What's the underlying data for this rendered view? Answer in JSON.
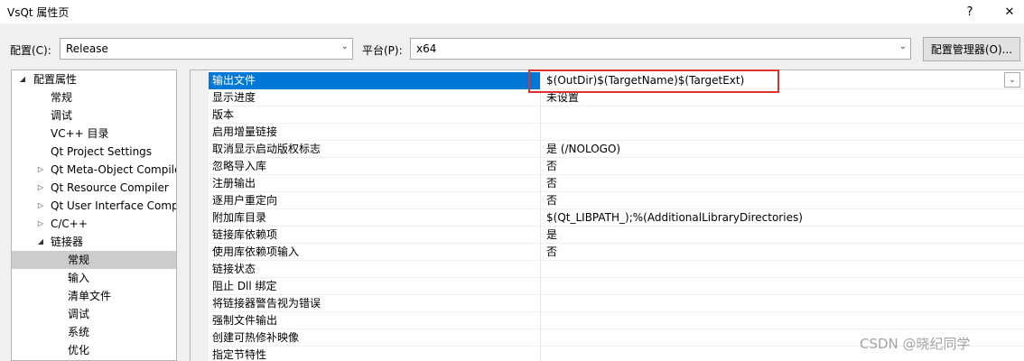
{
  "window": {
    "title": "VsQt 属性页",
    "help_label": "?",
    "close_label": "✕"
  },
  "config_bar": {
    "config_label": "配置(C):",
    "config_value": "Release",
    "platform_label": "平台(P):",
    "platform_value": "x64",
    "manager_button": "配置管理器(O)..."
  },
  "tree": {
    "items": [
      {
        "label": "配置属性",
        "toggle": "◢"
      },
      {
        "label": "常规",
        "toggle": ""
      },
      {
        "label": "调试",
        "toggle": ""
      },
      {
        "label": "VC++ 目录",
        "toggle": ""
      },
      {
        "label": "Qt Project Settings",
        "toggle": ""
      },
      {
        "label": "Qt Meta-Object Compile",
        "toggle": "▷"
      },
      {
        "label": "Qt Resource Compiler",
        "toggle": "▷"
      },
      {
        "label": "Qt User Interface Comp",
        "toggle": "▷"
      },
      {
        "label": "C/C++",
        "toggle": "▷"
      },
      {
        "label": "链接器",
        "toggle": "◢"
      },
      {
        "label": "常规",
        "toggle": ""
      },
      {
        "label": "输入",
        "toggle": ""
      },
      {
        "label": "清单文件",
        "toggle": ""
      },
      {
        "label": "调试",
        "toggle": ""
      },
      {
        "label": "系统",
        "toggle": ""
      },
      {
        "label": "优化",
        "toggle": ""
      }
    ]
  },
  "properties": [
    {
      "name": "输出文件",
      "value": "$(OutDir)$(TargetName)$(TargetExt)"
    },
    {
      "name": "显示进度",
      "value": "未设置"
    },
    {
      "name": "版本",
      "value": ""
    },
    {
      "name": "启用增量链接",
      "value": ""
    },
    {
      "name": "取消显示启动版权标志",
      "value": "是 (/NOLOGO)"
    },
    {
      "name": "忽略导入库",
      "value": "否"
    },
    {
      "name": "注册输出",
      "value": "否"
    },
    {
      "name": "逐用户重定向",
      "value": "否"
    },
    {
      "name": "附加库目录",
      "value": "$(Qt_LIBPATH_);%(AdditionalLibraryDirectories)"
    },
    {
      "name": "链接库依赖项",
      "value": "是"
    },
    {
      "name": "使用库依赖项输入",
      "value": "否"
    },
    {
      "name": "链接状态",
      "value": ""
    },
    {
      "name": "阻止 Dll 绑定",
      "value": ""
    },
    {
      "name": "将链接器警告视为错误",
      "value": ""
    },
    {
      "name": "强制文件输出",
      "value": ""
    },
    {
      "name": "创建可热修补映像",
      "value": ""
    },
    {
      "name": "指定节特性",
      "value": ""
    }
  ],
  "watermark": "CSDN @晓纪同学",
  "colors": {
    "selection": "#0078d7",
    "tree_selection": "#cccccc",
    "highlight_box": "#e03030"
  }
}
